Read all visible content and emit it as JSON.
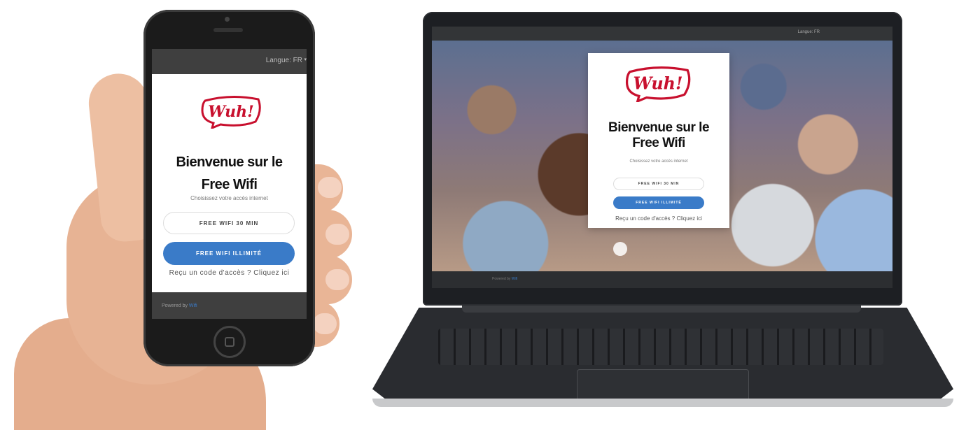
{
  "brand": {
    "logo_text": "Wuh!",
    "accent": "#c8102e",
    "primary": "#3a7bc8"
  },
  "phone": {
    "language_selector": "Langue: FR",
    "title_line1": "Bienvenue sur le",
    "title_line2": "Free Wifi",
    "subtitle": "Choisissez votre accès internet",
    "btn_free30": "FREE WIFI 30 MIN",
    "btn_unlimited": "FREE WIFI ILLIMITÉ",
    "code_link": "Reçu un code d'accès ? Cliquez ici",
    "footer_prefix": "Powered by ",
    "footer_link": "Wifi"
  },
  "laptop": {
    "language_selector": "Langue: FR",
    "title_line1": "Bienvenue sur le",
    "title_line2": "Free Wifi",
    "subtitle": "Choisissez votre accès internet",
    "btn_free30": "FREE WIFI 30 MIN",
    "btn_unlimited": "FREE WIFI ILLIMITÉ",
    "code_link": "Reçu un code d'accès ? Cliquez ici",
    "footer_prefix": "Powered by ",
    "footer_link": "Wifi"
  }
}
